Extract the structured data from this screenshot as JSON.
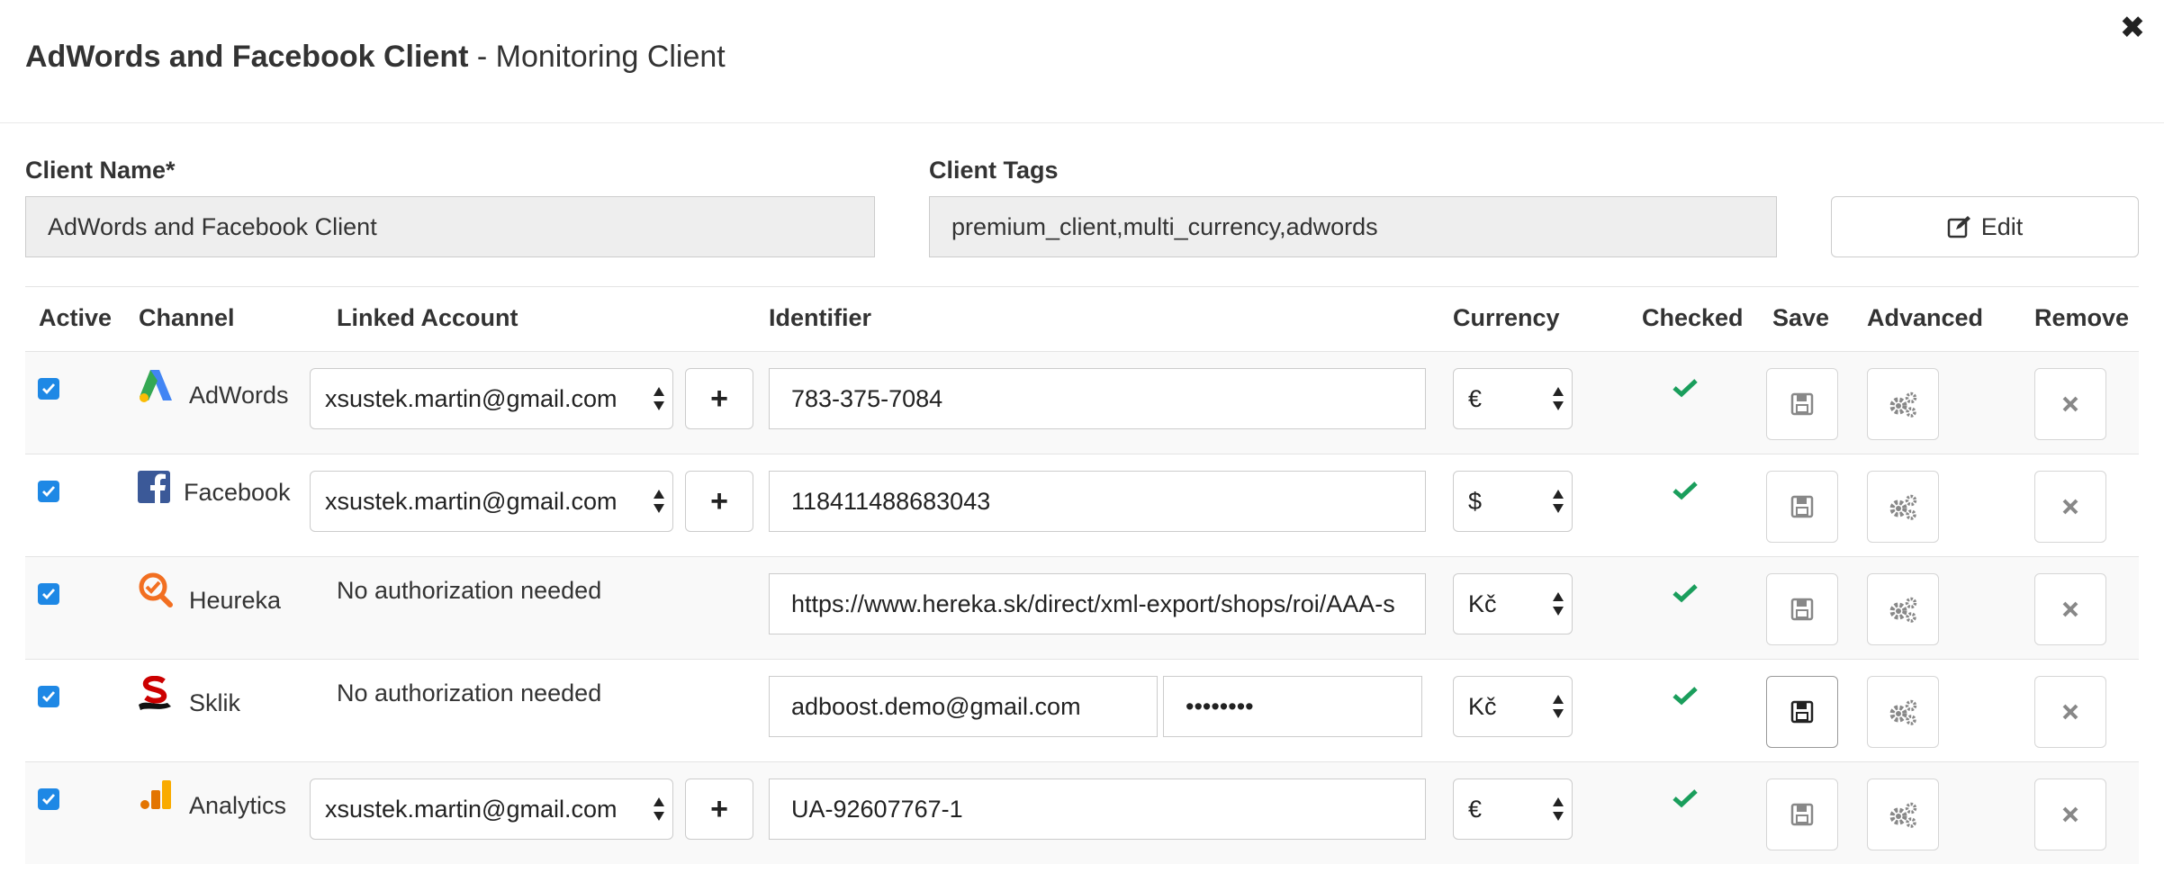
{
  "header": {
    "title_bold": "AdWords and Facebook Client",
    "title_rest": " - Monitoring Client"
  },
  "form": {
    "client_name_label": "Client Name*",
    "client_name_value": "AdWords and Facebook Client",
    "client_tags_label": "Client Tags",
    "client_tags_value": "premium_client,multi_currency,adwords",
    "edit_label": "Edit"
  },
  "table": {
    "headers": {
      "active": "Active",
      "channel": "Channel",
      "linked_account": "Linked Account",
      "identifier": "Identifier",
      "currency": "Currency",
      "checked": "Checked",
      "save": "Save",
      "advanced": "Advanced",
      "remove": "Remove"
    },
    "rows": [
      {
        "channel": "AdWords",
        "icon": "adwords-icon",
        "linked_account": "xsustek.martin@gmail.com",
        "identifier": "783-375-7084",
        "currency": "€"
      },
      {
        "channel": "Facebook",
        "icon": "facebook-icon",
        "linked_account": "xsustek.martin@gmail.com",
        "identifier": "118411488683043",
        "currency": "$"
      },
      {
        "channel": "Heureka",
        "icon": "heureka-icon",
        "linked_account": "No authorization needed",
        "identifier": "https://www.hereka.sk/direct/xml-export/shops/roi/AAA-s",
        "currency": "Kč"
      },
      {
        "channel": "Sklik",
        "icon": "sklik-icon",
        "linked_account": "No authorization needed",
        "identifier": "adboost.demo@gmail.com",
        "password": "••••••••",
        "currency": "Kč"
      },
      {
        "channel": "Analytics",
        "icon": "analytics-icon",
        "linked_account": "xsustek.martin@gmail.com",
        "identifier": "UA-92607767-1",
        "currency": "€"
      }
    ]
  },
  "colors": {
    "checkbox": "#1e88e5",
    "checkmark": "#1a9e5c",
    "field_bg": "#eeeeee",
    "adwords_blue": "#4285f4",
    "adwords_green": "#34a853",
    "adwords_yellow": "#fbbc05",
    "facebook_blue": "#3b5998",
    "heureka_orange": "#f26f21",
    "sklik_red": "#cc0000",
    "analytics_orange": "#f9ab00"
  }
}
